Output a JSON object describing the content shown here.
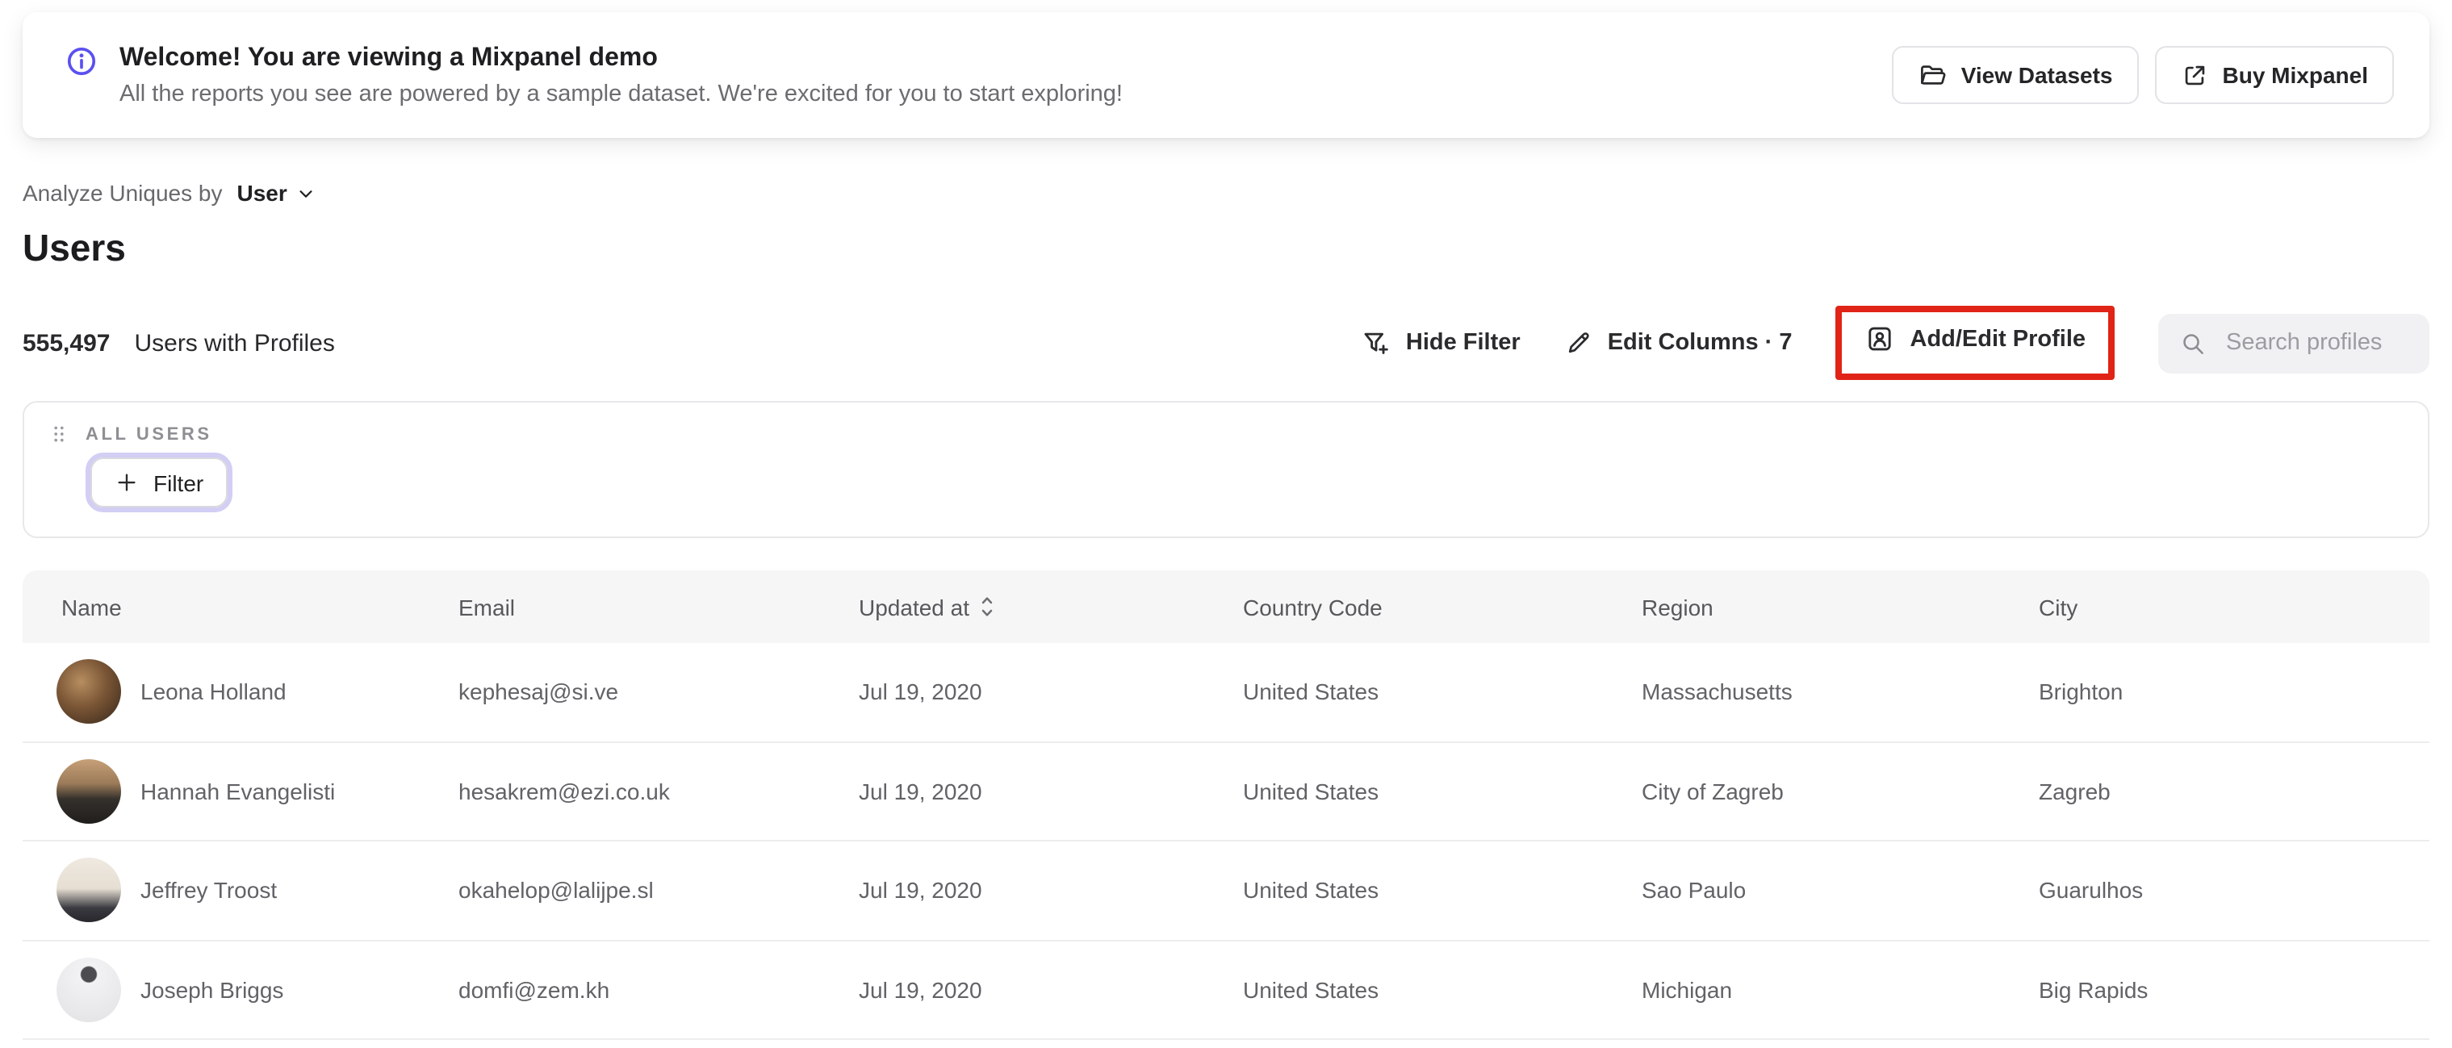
{
  "banner": {
    "title": "Welcome! You are viewing a Mixpanel demo",
    "subtitle": "All the reports you see are powered by a sample dataset. We're excited for you to start exploring!",
    "view_datasets_label": "View Datasets",
    "buy_mixpanel_label": "Buy Mixpanel"
  },
  "controls": {
    "analyze_label": "Analyze Uniques by",
    "analyze_value": "User",
    "page_title": "Users",
    "count": "555,497",
    "count_label": "Users with Profiles"
  },
  "toolbar": {
    "hide_filter_label": "Hide Filter",
    "edit_columns_label": "Edit Columns · 7",
    "add_edit_profile_label": "Add/Edit Profile",
    "search_placeholder": "Search profiles"
  },
  "filter_panel": {
    "group_label": "ALL USERS",
    "filter_button_label": "Filter"
  },
  "table": {
    "columns": [
      "Name",
      "Email",
      "Updated at",
      "Country Code",
      "Region",
      "City"
    ],
    "rows": [
      {
        "name": "Leona Holland",
        "email": "kephesaj@si.ve",
        "updated_at": "Jul 19, 2020",
        "country_code": "United States",
        "region": "Massachusetts",
        "city": "Brighton"
      },
      {
        "name": "Hannah Evangelisti",
        "email": "hesakrem@ezi.co.uk",
        "updated_at": "Jul 19, 2020",
        "country_code": "United States",
        "region": "City of Zagreb",
        "city": "Zagreb"
      },
      {
        "name": "Jeffrey Troost",
        "email": "okahelop@lalijpe.sl",
        "updated_at": "Jul 19, 2020",
        "country_code": "United States",
        "region": "Sao Paulo",
        "city": "Guarulhos"
      },
      {
        "name": "Joseph Briggs",
        "email": "domfi@zem.kh",
        "updated_at": "Jul 19, 2020",
        "country_code": "United States",
        "region": "Michigan",
        "city": "Big Rapids"
      }
    ]
  },
  "colors": {
    "accent_purple": "#5a50f0",
    "annotation_red": "#e02417"
  }
}
